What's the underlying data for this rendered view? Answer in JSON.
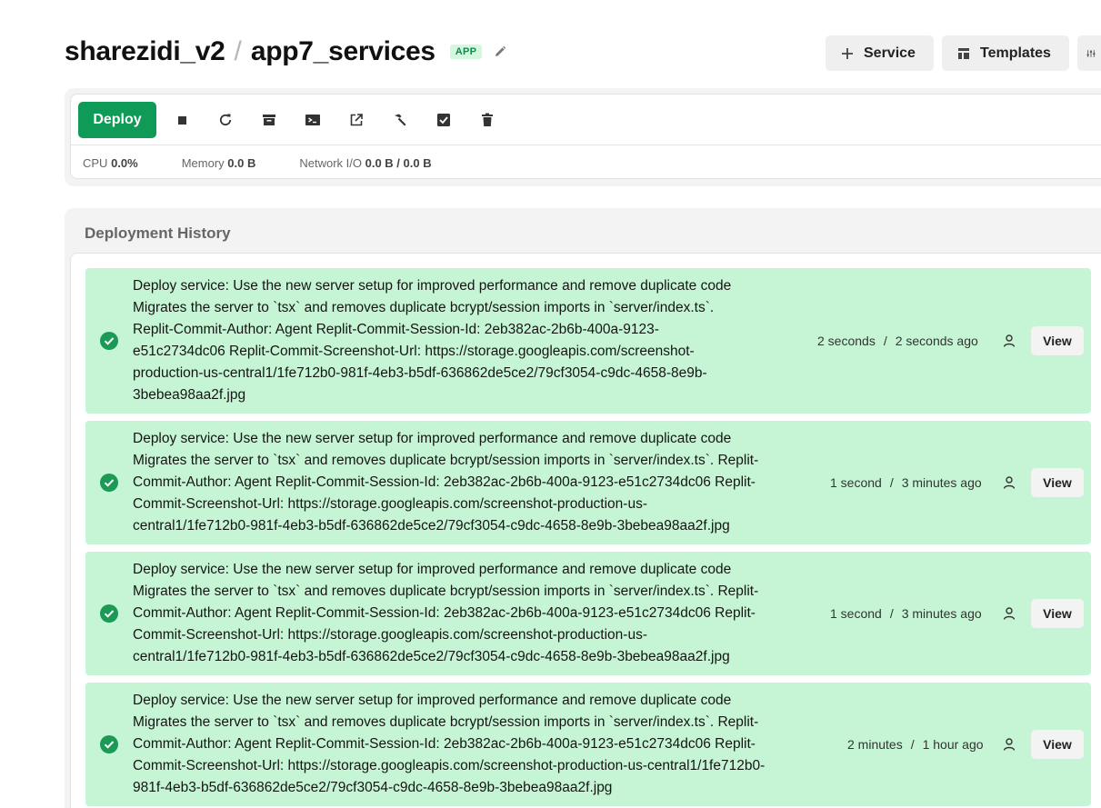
{
  "header": {
    "project": "sharezidi_v2",
    "separator": "/",
    "service": "app7_services",
    "badge": "APP"
  },
  "top_actions": {
    "service_label": "Service",
    "templates_label": "Templates"
  },
  "toolbar": {
    "deploy_label": "Deploy",
    "icons": [
      "stop-icon",
      "restart-icon",
      "archive-icon",
      "terminal-icon",
      "open-external-icon",
      "build-hammer-icon",
      "checkbox-icon",
      "trash-icon"
    ]
  },
  "stats": {
    "cpu_label": "CPU",
    "cpu_value": "0.0%",
    "memory_label": "Memory",
    "memory_value": "0.0 B",
    "network_label": "Network I/O",
    "network_value": "0.0 B / 0.0 B"
  },
  "history": {
    "title": "Deployment History",
    "view_label": "View",
    "entries": [
      {
        "lines": [
          "Deploy service: Use the new server setup for improved performance and remove duplicate code",
          "Migrates the server to `tsx` and removes duplicate bcrypt/session imports in `server/index.ts`.",
          "Replit-Commit-Author: Agent Replit-Commit-Session-Id: 2eb382ac-2b6b-400a-9123-",
          "e51c2734dc06 Replit-Commit-Screenshot-Url: https://storage.googleapis.com/screenshot-",
          "production-us-central1/1fe712b0-981f-4eb3-b5df-636862de5ce2/79cf3054-c9dc-4658-8e9b-",
          "3bebea98aa2f.jpg"
        ],
        "duration": "2 seconds",
        "ago": "2 seconds ago",
        "status_color": "#1a9a55"
      },
      {
        "lines": [
          "Deploy service: Use the new server setup for improved performance and remove duplicate code",
          "Migrates the server to `tsx` and removes duplicate bcrypt/session imports in `server/index.ts`. Replit-",
          "Commit-Author: Agent Replit-Commit-Session-Id: 2eb382ac-2b6b-400a-9123-e51c2734dc06 Replit-",
          "Commit-Screenshot-Url: https://storage.googleapis.com/screenshot-production-us-",
          "central1/1fe712b0-981f-4eb3-b5df-636862de5ce2/79cf3054-c9dc-4658-8e9b-3bebea98aa2f.jpg"
        ],
        "duration": "1 second",
        "ago": "3 minutes ago",
        "status_color": "#1a9a55"
      },
      {
        "lines": [
          "Deploy service: Use the new server setup for improved performance and remove duplicate code",
          "Migrates the server to `tsx` and removes duplicate bcrypt/session imports in `server/index.ts`. Replit-",
          "Commit-Author: Agent Replit-Commit-Session-Id: 2eb382ac-2b6b-400a-9123-e51c2734dc06 Replit-",
          "Commit-Screenshot-Url: https://storage.googleapis.com/screenshot-production-us-",
          "central1/1fe712b0-981f-4eb3-b5df-636862de5ce2/79cf3054-c9dc-4658-8e9b-3bebea98aa2f.jpg"
        ],
        "duration": "1 second",
        "ago": "3 minutes ago",
        "status_color": "#1a9a55"
      },
      {
        "lines": [
          "Deploy service: Use the new server setup for improved performance and remove duplicate code",
          "Migrates the server to `tsx` and removes duplicate bcrypt/session imports in `server/index.ts`. Replit-",
          "Commit-Author: Agent Replit-Commit-Session-Id: 2eb382ac-2b6b-400a-9123-e51c2734dc06 Replit-",
          "Commit-Screenshot-Url: https://storage.googleapis.com/screenshot-production-us-central1/1fe712b0-",
          "981f-4eb3-b5df-636862de5ce2/79cf3054-c9dc-4658-8e9b-3bebea98aa2f.jpg"
        ],
        "duration": "2 minutes",
        "ago": "1 hour ago",
        "status_color": "#1a9a55"
      }
    ]
  }
}
